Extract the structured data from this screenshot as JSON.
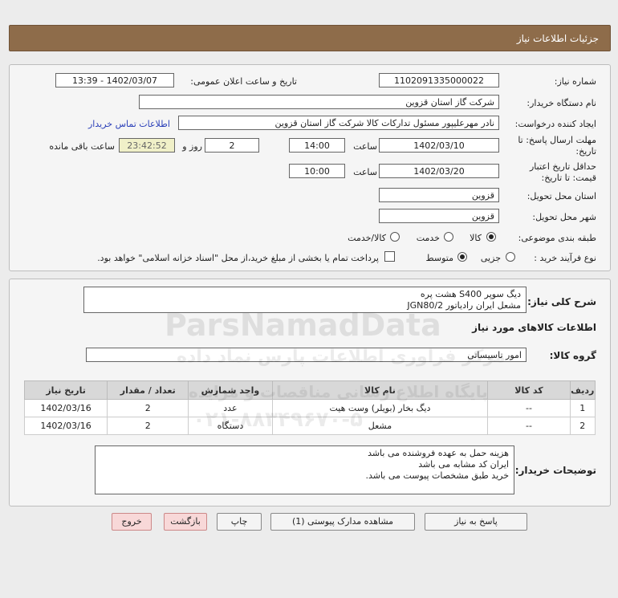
{
  "header": {
    "title": "جزئیات اطلاعات نیاز"
  },
  "form": {
    "need_number_label": "شماره نیاز:",
    "need_number": "1102091335000022",
    "announce_label": "تاریخ و ساعت اعلان عمومی:",
    "announce_value": "1402/03/07 - 13:39",
    "buyer_label": "نام دستگاه خریدار:",
    "buyer_value": "شرکت گاز استان قزوین",
    "creator_label": "ایجاد کننده درخواست:",
    "creator_value": "نادر مهرعلیپور مسئول تداركات كالا شرکت گاز استان قزوین",
    "contact_link": "اطلاعات تماس خریدار",
    "deadline_label_1": "مهلت ارسال پاسخ: تا",
    "deadline_label_2": "تاریخ:",
    "deadline_date": "1402/03/10",
    "time_label": "ساعت",
    "deadline_time": "14:00",
    "days_value": "2",
    "days_label": "روز و",
    "remaining_time": "23:42:52",
    "remaining_label": "ساعت باقی مانده",
    "validity_label_1": "حداقل تاریخ اعتبار",
    "validity_label_2": "قیمت: تا تاریخ:",
    "validity_date": "1402/03/20",
    "validity_time_label": "ساعت",
    "validity_time": "10:00",
    "province_label": "استان محل تحویل:",
    "province_value": "قزوین",
    "city_label": "شهر محل تحویل:",
    "city_value": "قزوین",
    "category_label": "طبقه بندی موضوعی:",
    "category_options": [
      "کالا",
      "خدمت",
      "کالا/خدمت"
    ],
    "category_selected": "کالا",
    "process_label": "نوع فرآیند خرید :",
    "process_options": [
      "جزیی",
      "متوسط"
    ],
    "process_selected": "متوسط",
    "payment_note": "پرداخت تمام یا بخشی از مبلغ خرید،از محل \"اسناد خزانه اسلامی\" خواهد بود."
  },
  "summary": {
    "label": "شرح کلی نیاز:",
    "line1": "دیگ سوپر S400 هشت پره",
    "line2": "مشعل ایران رادیاتور JGN80/2"
  },
  "goods_info": {
    "title": "اطلاعات کالاهای مورد نیاز",
    "group_label": "گروه کالا:",
    "group_value": "امور تاسیساتی"
  },
  "table": {
    "headers": [
      "ردیف",
      "کد کالا",
      "نام کالا",
      "واحد شمارش",
      "تعداد / مقدار",
      "تاریخ نیاز"
    ],
    "rows": [
      [
        "1",
        "--",
        "دیگ بخار (بویلر) وست هیت",
        "عدد",
        "2",
        "1402/03/16"
      ],
      [
        "2",
        "--",
        "مشعل",
        "دستگاه",
        "2",
        "1402/03/16"
      ]
    ]
  },
  "notes": {
    "label": "توضیحات خریدار:",
    "line1": "هزینه حمل به عهده فروشنده می باشد",
    "line2": "ایران کد مشابه می باشد",
    "line3": "خرید طبق مشخصات پیوست می باشد."
  },
  "buttons": {
    "reply": "پاسخ به نیاز",
    "attachments": "مشاهده مدارک پیوستی (1)",
    "print": "چاپ",
    "back": "بازگشت",
    "exit": "خروج"
  },
  "watermark": {
    "brand": "ParsNamadData",
    "line_fa_1": "مرکز فراوری اطلاعات پارس نماد داده",
    "line_fa_2": "پایگاه اطلاع رسانی مناقصات و مزایده",
    "phone": "۰۲۱-۸۸۳۴۹۶۷۰-۵"
  },
  "colors": {
    "header": "#8e6c4a",
    "link": "#2a3fb8",
    "remaining_bg": "#f0f0c8"
  }
}
